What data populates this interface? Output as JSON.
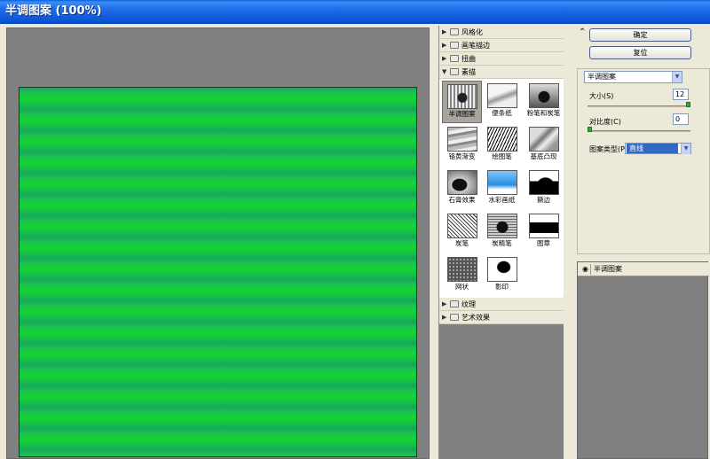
{
  "window": {
    "title": "半调图案 (100%)"
  },
  "gallery": {
    "categories_top": [
      {
        "label": "风格化",
        "expanded": false
      },
      {
        "label": "画笔描边",
        "expanded": false
      },
      {
        "label": "扭曲",
        "expanded": false
      },
      {
        "label": "素描",
        "expanded": true
      }
    ],
    "thumbnails": [
      {
        "label": "半调图案",
        "selected": true,
        "icon": "halftone-thumb"
      },
      {
        "label": "便条纸",
        "selected": false,
        "icon": "notepaper-thumb"
      },
      {
        "label": "粉笔和炭笔",
        "selected": false,
        "icon": "chalk-charcoal-thumb"
      },
      {
        "label": "铬黄渐变",
        "selected": false,
        "icon": "chrome-thumb"
      },
      {
        "label": "绘图笔",
        "selected": false,
        "icon": "graphic-pen-thumb"
      },
      {
        "label": "基底凸现",
        "selected": false,
        "icon": "bas-relief-thumb"
      },
      {
        "label": "石膏效果",
        "selected": false,
        "icon": "plaster-thumb"
      },
      {
        "label": "水彩画纸",
        "selected": false,
        "icon": "water-paper-thumb"
      },
      {
        "label": "撕边",
        "selected": false,
        "icon": "torn-edges-thumb"
      },
      {
        "label": "炭笔",
        "selected": false,
        "icon": "charcoal-thumb"
      },
      {
        "label": "炭精笔",
        "selected": false,
        "icon": "conte-crayon-thumb"
      },
      {
        "label": "图章",
        "selected": false,
        "icon": "stamp-thumb"
      },
      {
        "label": "网状",
        "selected": false,
        "icon": "reticulation-thumb"
      },
      {
        "label": "影印",
        "selected": false,
        "icon": "photocopy-thumb"
      }
    ],
    "categories_bottom": [
      {
        "label": "纹理",
        "expanded": false
      },
      {
        "label": "艺术效果",
        "expanded": false
      }
    ]
  },
  "buttons": {
    "ok": "确定",
    "reset": "复位"
  },
  "settings": {
    "filter_select": "半调图案",
    "size_label": "大小(S)",
    "size_value": "12",
    "size_fraction": 1.0,
    "contrast_label": "对比度(C)",
    "contrast_value": "0",
    "contrast_fraction": 0.0,
    "pattern_type_label": "图案类型(P):",
    "pattern_type_value": "直线"
  },
  "layers": {
    "items": [
      "半调图案"
    ]
  },
  "colors": {
    "title_bar": "#1f6ce8",
    "pattern_dark": "#12a95c",
    "pattern_light": "#12d433",
    "selection": "#316ac5"
  }
}
